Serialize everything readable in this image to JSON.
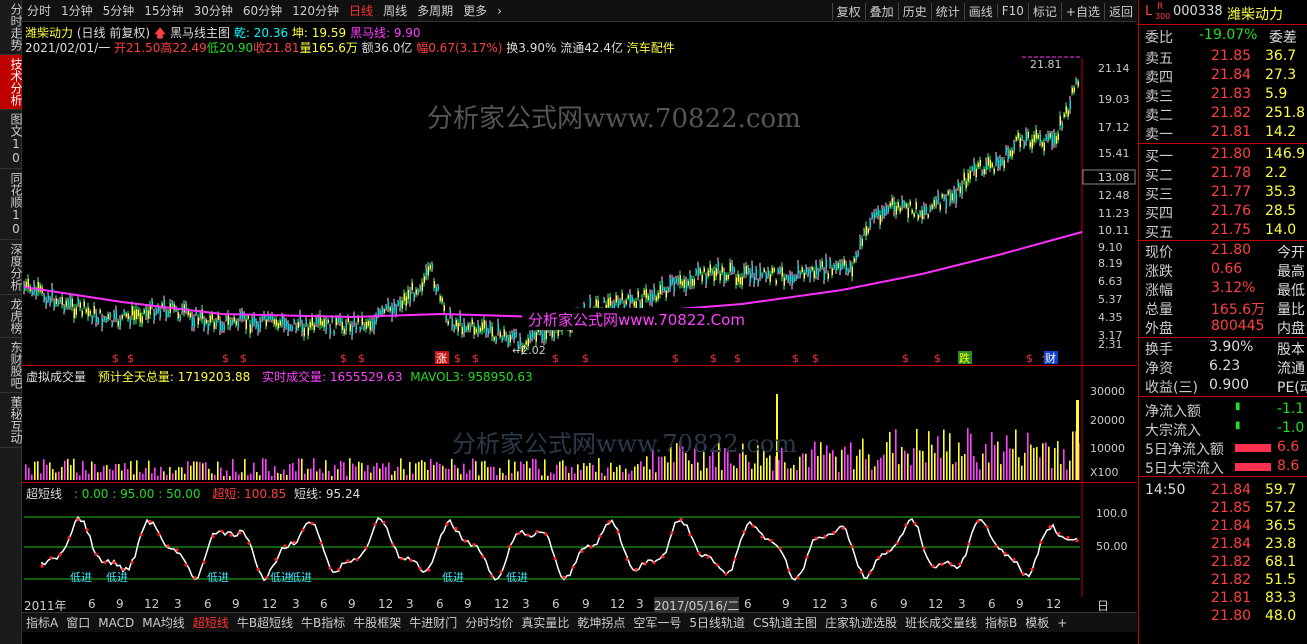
{
  "left_tabs": [
    "分时走势",
    "技术分析",
    "图文10",
    "同花顺10",
    "深度分析",
    "龙虎榜",
    "东财股吧",
    "董秘互动"
  ],
  "active_left_tab": 1,
  "timeframes": [
    "分时",
    "1分钟",
    "5分钟",
    "15分钟",
    "30分钟",
    "60分钟",
    "120分钟",
    "日线",
    "周线",
    "多周期",
    "更多"
  ],
  "active_timeframe": 7,
  "toolbar": [
    "复权",
    "叠加",
    "历史",
    "统计",
    "画线",
    "F10",
    "标记",
    "+自选",
    "返回"
  ],
  "info": {
    "title": "潍柴动力",
    "mode": "(日线 前复权)",
    "indicator": "黑马线主图",
    "qian": "乾: 20.36",
    "kun": "坤: 19.59",
    "heima": "黑马线: 9.90",
    "date": "2021/02/01/一",
    "open": "开21.50",
    "high": "高22.49",
    "low": "低20.90",
    "close": "收21.81",
    "vol": "量165.6万",
    "amount": "额36.0亿",
    "amp": "幅0.67(3.17%)",
    "turnover": "换3.90%",
    "float": "流通42.4亿",
    "sector": "汽车配件"
  },
  "watermark1": "分析家公式网www.70822.com",
  "watermark2": "分析家公式网www.70822.Com",
  "price_axis": [
    "21.14",
    "19.03",
    "17.12",
    "15.41",
    "13.08",
    "12.48",
    "11.23",
    "10.11",
    "9.10",
    "8.19",
    "6.63",
    "5.37",
    "4.35",
    "3.17",
    "2.31"
  ],
  "price_hi_label": "21.81",
  "price_lo_label": "2.02",
  "vol_panel": {
    "title": "虚拟成交量",
    "forecast": "预计全天总量: 1719203.88",
    "realtime": "实时成交量: 1655529.63",
    "mavol": "MAVOL3: 958950.63",
    "axis": [
      "30000",
      "20000",
      "10000",
      "X100"
    ]
  },
  "osc_panel": {
    "title": "超短线",
    "params": ": 0.00 : 95.00 : 50.00",
    "chao": "超短: 100.85",
    "duan": "短线: 95.24",
    "axis": [
      "100.0",
      "50.00"
    ],
    "labels": [
      "低进",
      "低进",
      "低进",
      "低进",
      "低进",
      "低进"
    ]
  },
  "x_axis": [
    "2011年",
    "6",
    "9",
    "12",
    "3",
    "6",
    "9",
    "12",
    "3",
    "6",
    "9",
    "12",
    "3",
    "6",
    "9",
    "12",
    "3",
    "6",
    "9",
    "12",
    "3",
    "2017/05/16/二",
    "6",
    "9",
    "12",
    "3",
    "6",
    "9",
    "12",
    "3",
    "6",
    "9",
    "12"
  ],
  "x_axis_right": "日线",
  "bottom_tabs": [
    "指标A",
    "窗口",
    "MACD",
    "MA均线",
    "超短线",
    "牛B超短线",
    "牛B指标",
    "牛股框架",
    "牛进财门",
    "分时均价",
    "真实量比",
    "乾坤拐点",
    "空军一号",
    "5日线轨道",
    "CS轨道主图",
    "庄家轨迹选股",
    "班长成交量线",
    "指标B",
    "模板",
    "+"
  ],
  "active_bottom_tab": 4,
  "quote": {
    "code": "000338",
    "name": "潍柴动力",
    "weibi_label": "委比",
    "weibi": "-19.07%",
    "weicha_label": "委差",
    "asks": [
      {
        "label": "卖五",
        "price": "21.85",
        "vol": "36.7"
      },
      {
        "label": "卖四",
        "price": "21.84",
        "vol": "27.3"
      },
      {
        "label": "卖三",
        "price": "21.83",
        "vol": "5.9"
      },
      {
        "label": "卖二",
        "price": "21.82",
        "vol": "251.8"
      },
      {
        "label": "卖一",
        "price": "21.81",
        "vol": "14.2"
      }
    ],
    "bids": [
      {
        "label": "买一",
        "price": "21.80",
        "vol": "146.9"
      },
      {
        "label": "买二",
        "price": "21.78",
        "vol": "2.2"
      },
      {
        "label": "买三",
        "price": "21.77",
        "vol": "35.3"
      },
      {
        "label": "买四",
        "price": "21.76",
        "vol": "28.5"
      },
      {
        "label": "买五",
        "price": "21.75",
        "vol": "14.0"
      }
    ],
    "stats": [
      {
        "l": "现价",
        "v": "21.80",
        "l2": "今开"
      },
      {
        "l": "涨跌",
        "v": "0.66",
        "l2": "最高"
      },
      {
        "l": "涨幅",
        "v": "3.12%",
        "l2": "最低"
      },
      {
        "l": "总量",
        "v": "165.6万",
        "l2": "量比"
      },
      {
        "l": "外盘",
        "v": "800445",
        "l2": "内盘"
      }
    ],
    "stats2": [
      {
        "l": "换手",
        "v": "3.90%",
        "l2": "股本"
      },
      {
        "l": "净资",
        "v": "6.23",
        "l2": "流通"
      },
      {
        "l": "收益(三)",
        "v": "0.900",
        "l2": "PE(动"
      }
    ],
    "flows": [
      {
        "l": "净流入额",
        "v": "-1.1"
      },
      {
        "l": "大宗流入",
        "v": "-1.0"
      },
      {
        "l": "5日净流入额",
        "v": "6.6"
      },
      {
        "l": "5日大宗流入",
        "v": "8.6"
      }
    ],
    "ticks": [
      {
        "t": "14:50",
        "p": "21.84",
        "v": "59.7"
      },
      {
        "t": "",
        "p": "21.85",
        "v": "57.2"
      },
      {
        "t": "",
        "p": "21.84",
        "v": "36.5"
      },
      {
        "t": "",
        "p": "21.84",
        "v": "23.8"
      },
      {
        "t": "",
        "p": "21.82",
        "v": "68.1"
      },
      {
        "t": "",
        "p": "21.82",
        "v": "51.5"
      },
      {
        "t": "",
        "p": "21.81",
        "v": "83.3"
      },
      {
        "t": "",
        "p": "21.80",
        "v": "48.0"
      }
    ]
  }
}
